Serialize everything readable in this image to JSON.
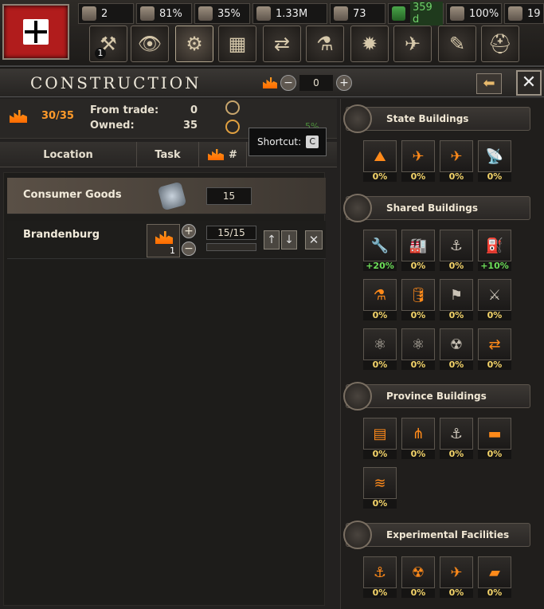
{
  "topbar": {
    "flag_name": "national-flag",
    "resources": [
      {
        "icon": "political-power-icon",
        "value": "2"
      },
      {
        "icon": "stability-icon",
        "value": "81%"
      },
      {
        "icon": "war-support-icon",
        "value": "35%"
      },
      {
        "icon": "manpower-icon",
        "value": "1.33M"
      },
      {
        "icon": "factories-icon",
        "value": "73"
      },
      {
        "icon": "fuel-icon",
        "value": "359 d"
      },
      {
        "icon": "supply-icon",
        "value": "100%"
      },
      {
        "icon": "convoys-icon",
        "value": "19"
      }
    ],
    "menu": [
      {
        "icon": "politics-icon",
        "glyph": "⚒",
        "badge": "1"
      },
      {
        "icon": "diplomacy-icon",
        "glyph": "👁",
        "badge": ""
      },
      {
        "icon": "construction-icon",
        "glyph": "⚙",
        "badge": ""
      },
      {
        "icon": "production-icon",
        "glyph": "▦",
        "badge": ""
      },
      {
        "icon": "trade-icon",
        "glyph": "⇄",
        "badge": ""
      },
      {
        "icon": "research-icon",
        "glyph": "⚗",
        "badge": ""
      },
      {
        "icon": "logistics-icon",
        "glyph": "✹",
        "badge": ""
      },
      {
        "icon": "air-icon",
        "glyph": "✈",
        "badge": ""
      },
      {
        "icon": "decisions-icon",
        "glyph": "✎",
        "badge": ""
      },
      {
        "icon": "army-icon",
        "glyph": "⛑",
        "badge": ""
      }
    ]
  },
  "panel": {
    "title": "Construction",
    "stepper_value": "0",
    "stats": {
      "factories_count": "30/35",
      "from_trade_label": "From trade:",
      "from_trade_value": "0",
      "owned_label": "Owned:",
      "owned_value": "35",
      "side_pct": "5%"
    },
    "tabs": {
      "location": "Location",
      "task": "Task",
      "hash": "#"
    },
    "tooltip": {
      "label": "Shortcut:",
      "key": "C"
    },
    "queue": [
      {
        "name": "Consumer Goods",
        "value": "15"
      },
      {
        "name": "Brandenburg",
        "progress": "15/15",
        "progress_fraction": 1.0,
        "level": "1"
      }
    ]
  },
  "buildings": {
    "state": {
      "title": "State Buildings",
      "items": [
        {
          "name": "infrastructure",
          "glyph": "⛰",
          "pct": "0%"
        },
        {
          "name": "anti-air",
          "glyph": "✈",
          "pct": "0%"
        },
        {
          "name": "airbase",
          "glyph": "✈",
          "pct": "0%"
        },
        {
          "name": "radar",
          "glyph": "📡",
          "pct": "0%",
          "gray": true
        }
      ]
    },
    "shared": {
      "title": "Shared Buildings",
      "items": [
        {
          "name": "civilian-factory",
          "glyph": "🔧",
          "pct": "+20%",
          "green": true,
          "gray": true
        },
        {
          "name": "military-factory",
          "glyph": "🏭",
          "pct": "0%"
        },
        {
          "name": "naval-dockyard",
          "glyph": "⚓",
          "pct": "0%",
          "gray": true
        },
        {
          "name": "fuel-silo",
          "glyph": "⛽",
          "pct": "+10%",
          "green": true,
          "gray": true
        },
        {
          "name": "synthetic-refinery",
          "glyph": "⚗",
          "pct": "0%"
        },
        {
          "name": "fuel-refinery",
          "glyph": "🛢",
          "pct": "0%"
        },
        {
          "name": "rocket-site",
          "glyph": "⚑",
          "pct": "0%",
          "gray": true
        },
        {
          "name": "railway-gun",
          "glyph": "⚔",
          "pct": "0%",
          "gray": true
        },
        {
          "name": "nuclear-reactor",
          "glyph": "⚛",
          "pct": "0%",
          "gray": true
        },
        {
          "name": "nuclear-reactor-2",
          "glyph": "⚛",
          "pct": "0%",
          "gray": true
        },
        {
          "name": "power-plant",
          "glyph": "☢",
          "pct": "0%",
          "gray": true
        },
        {
          "name": "supply-hub",
          "glyph": "⇄",
          "pct": "0%"
        }
      ]
    },
    "province": {
      "title": "Province Buildings",
      "items": [
        {
          "name": "land-fort",
          "glyph": "▤",
          "pct": "0%"
        },
        {
          "name": "railway",
          "glyph": "⋔",
          "pct": "0%"
        },
        {
          "name": "naval-base",
          "glyph": "⚓",
          "pct": "0%",
          "gray": true
        },
        {
          "name": "bunker",
          "glyph": "▬",
          "pct": "0%"
        },
        {
          "name": "coastal-fort",
          "glyph": "≋",
          "pct": "0%"
        }
      ]
    },
    "experimental": {
      "title": "Experimental Facilities",
      "items": [
        {
          "name": "naval-facility",
          "glyph": "⚓",
          "pct": "0%"
        },
        {
          "name": "nuclear-facility",
          "glyph": "☢",
          "pct": "0%"
        },
        {
          "name": "air-facility",
          "glyph": "✈",
          "pct": "0%"
        },
        {
          "name": "land-facility",
          "glyph": "▰",
          "pct": "0%"
        }
      ]
    }
  },
  "colors": {
    "accent": "#ff8a1a",
    "percent": "#f5d56a",
    "green": "#6ddf59"
  }
}
